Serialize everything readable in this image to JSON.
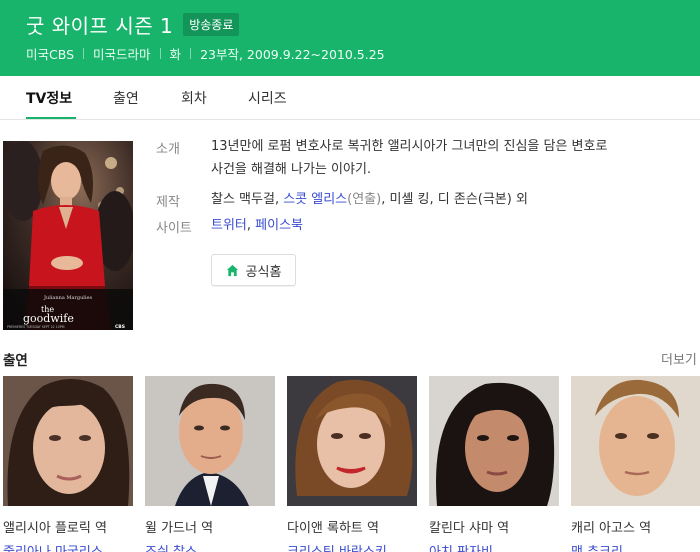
{
  "header": {
    "title": "굿 와이프 시즌 1",
    "badge": "방송종료",
    "network": "미국CBS",
    "genre": "미국드라마",
    "day": "화",
    "episodes_period": "23부작, 2009.9.22~2010.5.25",
    "background_color": "#19b46c"
  },
  "tabs": [
    {
      "label": "TV정보",
      "active": true
    },
    {
      "label": "출연",
      "active": false
    },
    {
      "label": "회차",
      "active": false
    },
    {
      "label": "시리즈",
      "active": false
    }
  ],
  "poster": {
    "actress_credit": "Julianna Margulies",
    "show_logo_the": "the",
    "show_logo_name": "goodwife",
    "premiere_text": "PREMIERES TUESDAY SEPT 22 10PM",
    "network_logo": "CBS"
  },
  "info": {
    "synopsis_label": "소개",
    "synopsis_line1": "13년만에 로펌 변호사로 복귀한 앨리시아가 그녀만의 진심을 담은 변호로",
    "synopsis_line2": "사건을 해결해 나가는 이야기.",
    "production_label": "제작",
    "producer1": "찰스 맥두걸",
    "producer_sep1": ", ",
    "producer2": "스콧 엘리스",
    "producer2_role": "(연출)",
    "producer_rest": ", 미셸 킹, 디 존슨(극본) 외",
    "site_label": "사이트",
    "site1": "트위터",
    "site_sep": ", ",
    "site2": "페이스북",
    "official_button": "공식홈"
  },
  "cast_section": {
    "title": "출연",
    "more_label": "더보기"
  },
  "cast": [
    {
      "role": "앨리시아 플로릭 역",
      "actor": "줄리아나 마굴리스"
    },
    {
      "role": "윌 가드너 역",
      "actor": "조쉬 찰스"
    },
    {
      "role": "다이앤 록하트 역",
      "actor": "크리스틴 바란스키"
    },
    {
      "role": "칼린다 샤마 역",
      "actor": "아치 판자비"
    },
    {
      "role": "캐리 아고스 역",
      "actor": "맷 츄크리"
    }
  ]
}
